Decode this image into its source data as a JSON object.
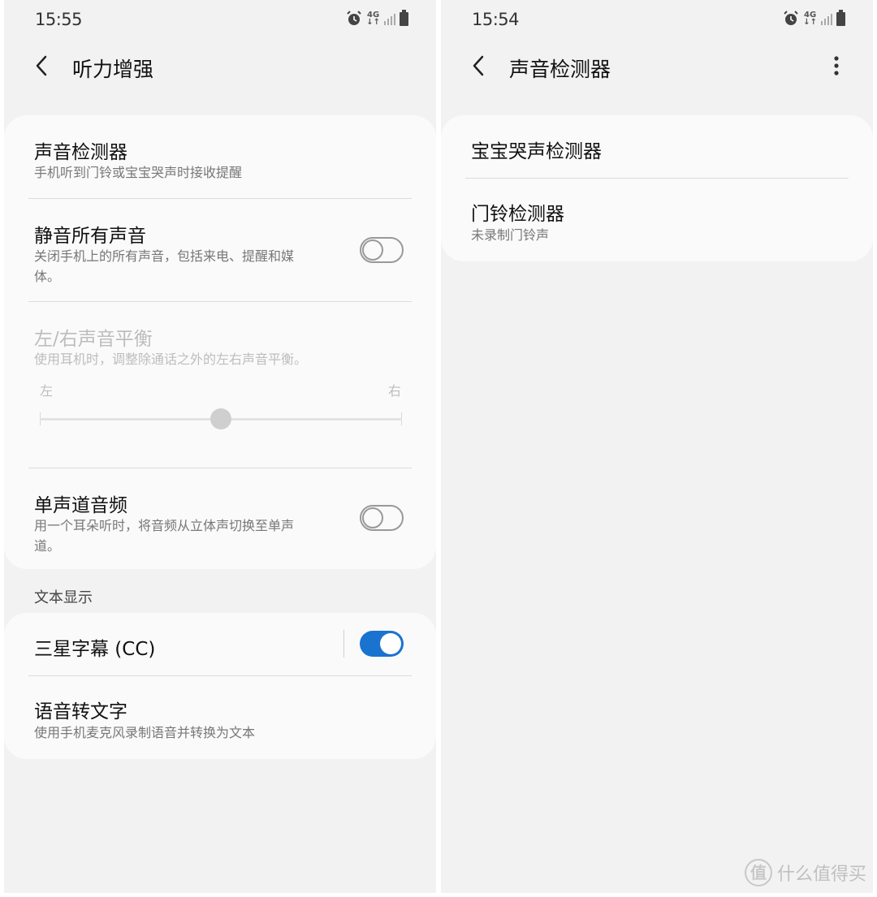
{
  "left": {
    "status": {
      "time": "15:55",
      "network": "4G"
    },
    "appbar": {
      "title": "听力增强"
    },
    "items": [
      {
        "title": "声音检测器",
        "subtitle": "手机听到门铃或宝宝哭声时接收提醒"
      },
      {
        "title": "静音所有声音",
        "subtitle_line1": "关闭手机上的所有声音，包括来电、提醒和媒",
        "subtitle_line2": "体。",
        "toggle": false
      },
      {
        "title": "左/右声音平衡",
        "subtitle": "使用耳机时，调整除通话之外的左右声音平衡。",
        "slider_left": "左",
        "slider_right": "右",
        "balance": 0.5,
        "enabled": false
      },
      {
        "title": "单声道音频",
        "subtitle_line1": "用一个耳朵听时，将音频从立体声切换至单声",
        "subtitle_line2": "道。",
        "toggle": false
      }
    ],
    "section_text": {
      "header": "文本显示"
    },
    "text_items": [
      {
        "title": "三星字幕 (CC)",
        "toggle": true
      },
      {
        "title": "语音转文字",
        "subtitle": "使用手机麦克风录制语音并转换为文本"
      }
    ]
  },
  "right": {
    "status": {
      "time": "15:54",
      "network": "4G"
    },
    "appbar": {
      "title": "声音检测器"
    },
    "items": [
      {
        "title": "宝宝哭声检测器"
      },
      {
        "title": "门铃检测器",
        "subtitle": "未录制门铃声"
      }
    ]
  },
  "watermark": {
    "icon_char": "值",
    "text": "什么值得买"
  },
  "colors": {
    "accent": "#1a73cf",
    "background": "#f2f2f2",
    "card": "#fafafa"
  }
}
